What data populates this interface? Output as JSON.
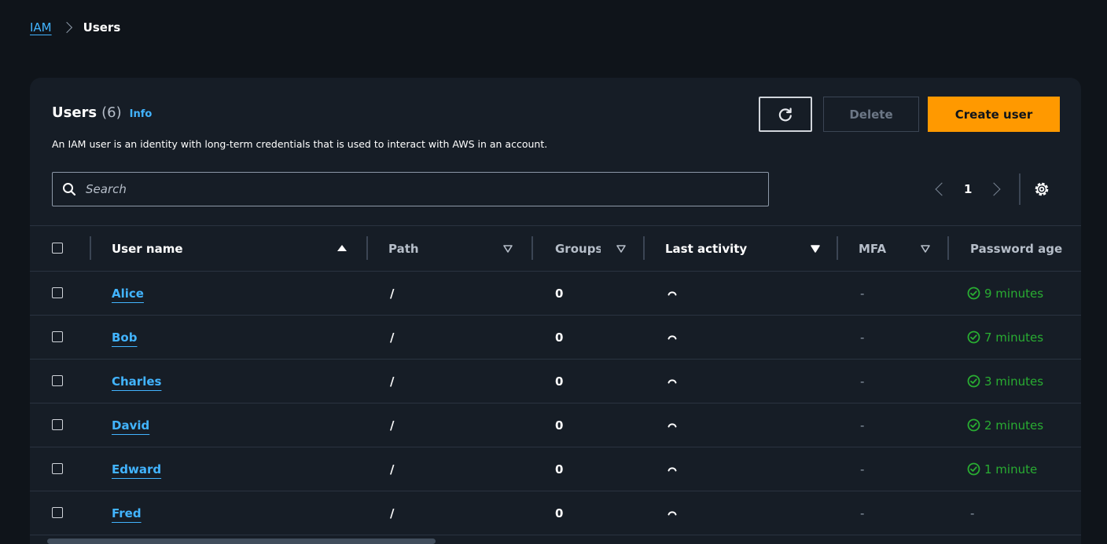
{
  "breadcrumb": {
    "parent": "IAM",
    "current": "Users"
  },
  "panel": {
    "title": "Users",
    "count": "(6)",
    "info": "Info",
    "description": "An IAM user is an identity with long-term credentials that is used to interact with AWS in an account."
  },
  "toolbar": {
    "refresh_icon": "refresh-icon",
    "delete_label": "Delete",
    "create_label": "Create user"
  },
  "search": {
    "placeholder": "Search",
    "value": ""
  },
  "pagination": {
    "current_page": "1"
  },
  "table": {
    "columns": {
      "user_name": "User name",
      "path": "Path",
      "groups": "Groups",
      "last_activity": "Last activity",
      "mfa": "MFA",
      "password_age": "Password age"
    },
    "rows": [
      {
        "user_name": "Alice",
        "path": "/",
        "groups": "0",
        "mfa": "-",
        "password_age": "9 minutes"
      },
      {
        "user_name": "Bob",
        "path": "/",
        "groups": "0",
        "mfa": "-",
        "password_age": "7 minutes"
      },
      {
        "user_name": "Charles",
        "path": "/",
        "groups": "0",
        "mfa": "-",
        "password_age": "3 minutes"
      },
      {
        "user_name": "David",
        "path": "/",
        "groups": "0",
        "mfa": "-",
        "password_age": "2 minutes"
      },
      {
        "user_name": "Edward",
        "path": "/",
        "groups": "0",
        "mfa": "-",
        "password_age": "1 minute"
      },
      {
        "user_name": "Fred",
        "path": "/",
        "groups": "0",
        "mfa": "-",
        "password_age": "-"
      }
    ]
  },
  "colors": {
    "accent_link": "#42b4ff",
    "primary_button": "#ff9900",
    "success": "#29ad32",
    "background": "#0f141a",
    "panel": "#161d26"
  }
}
